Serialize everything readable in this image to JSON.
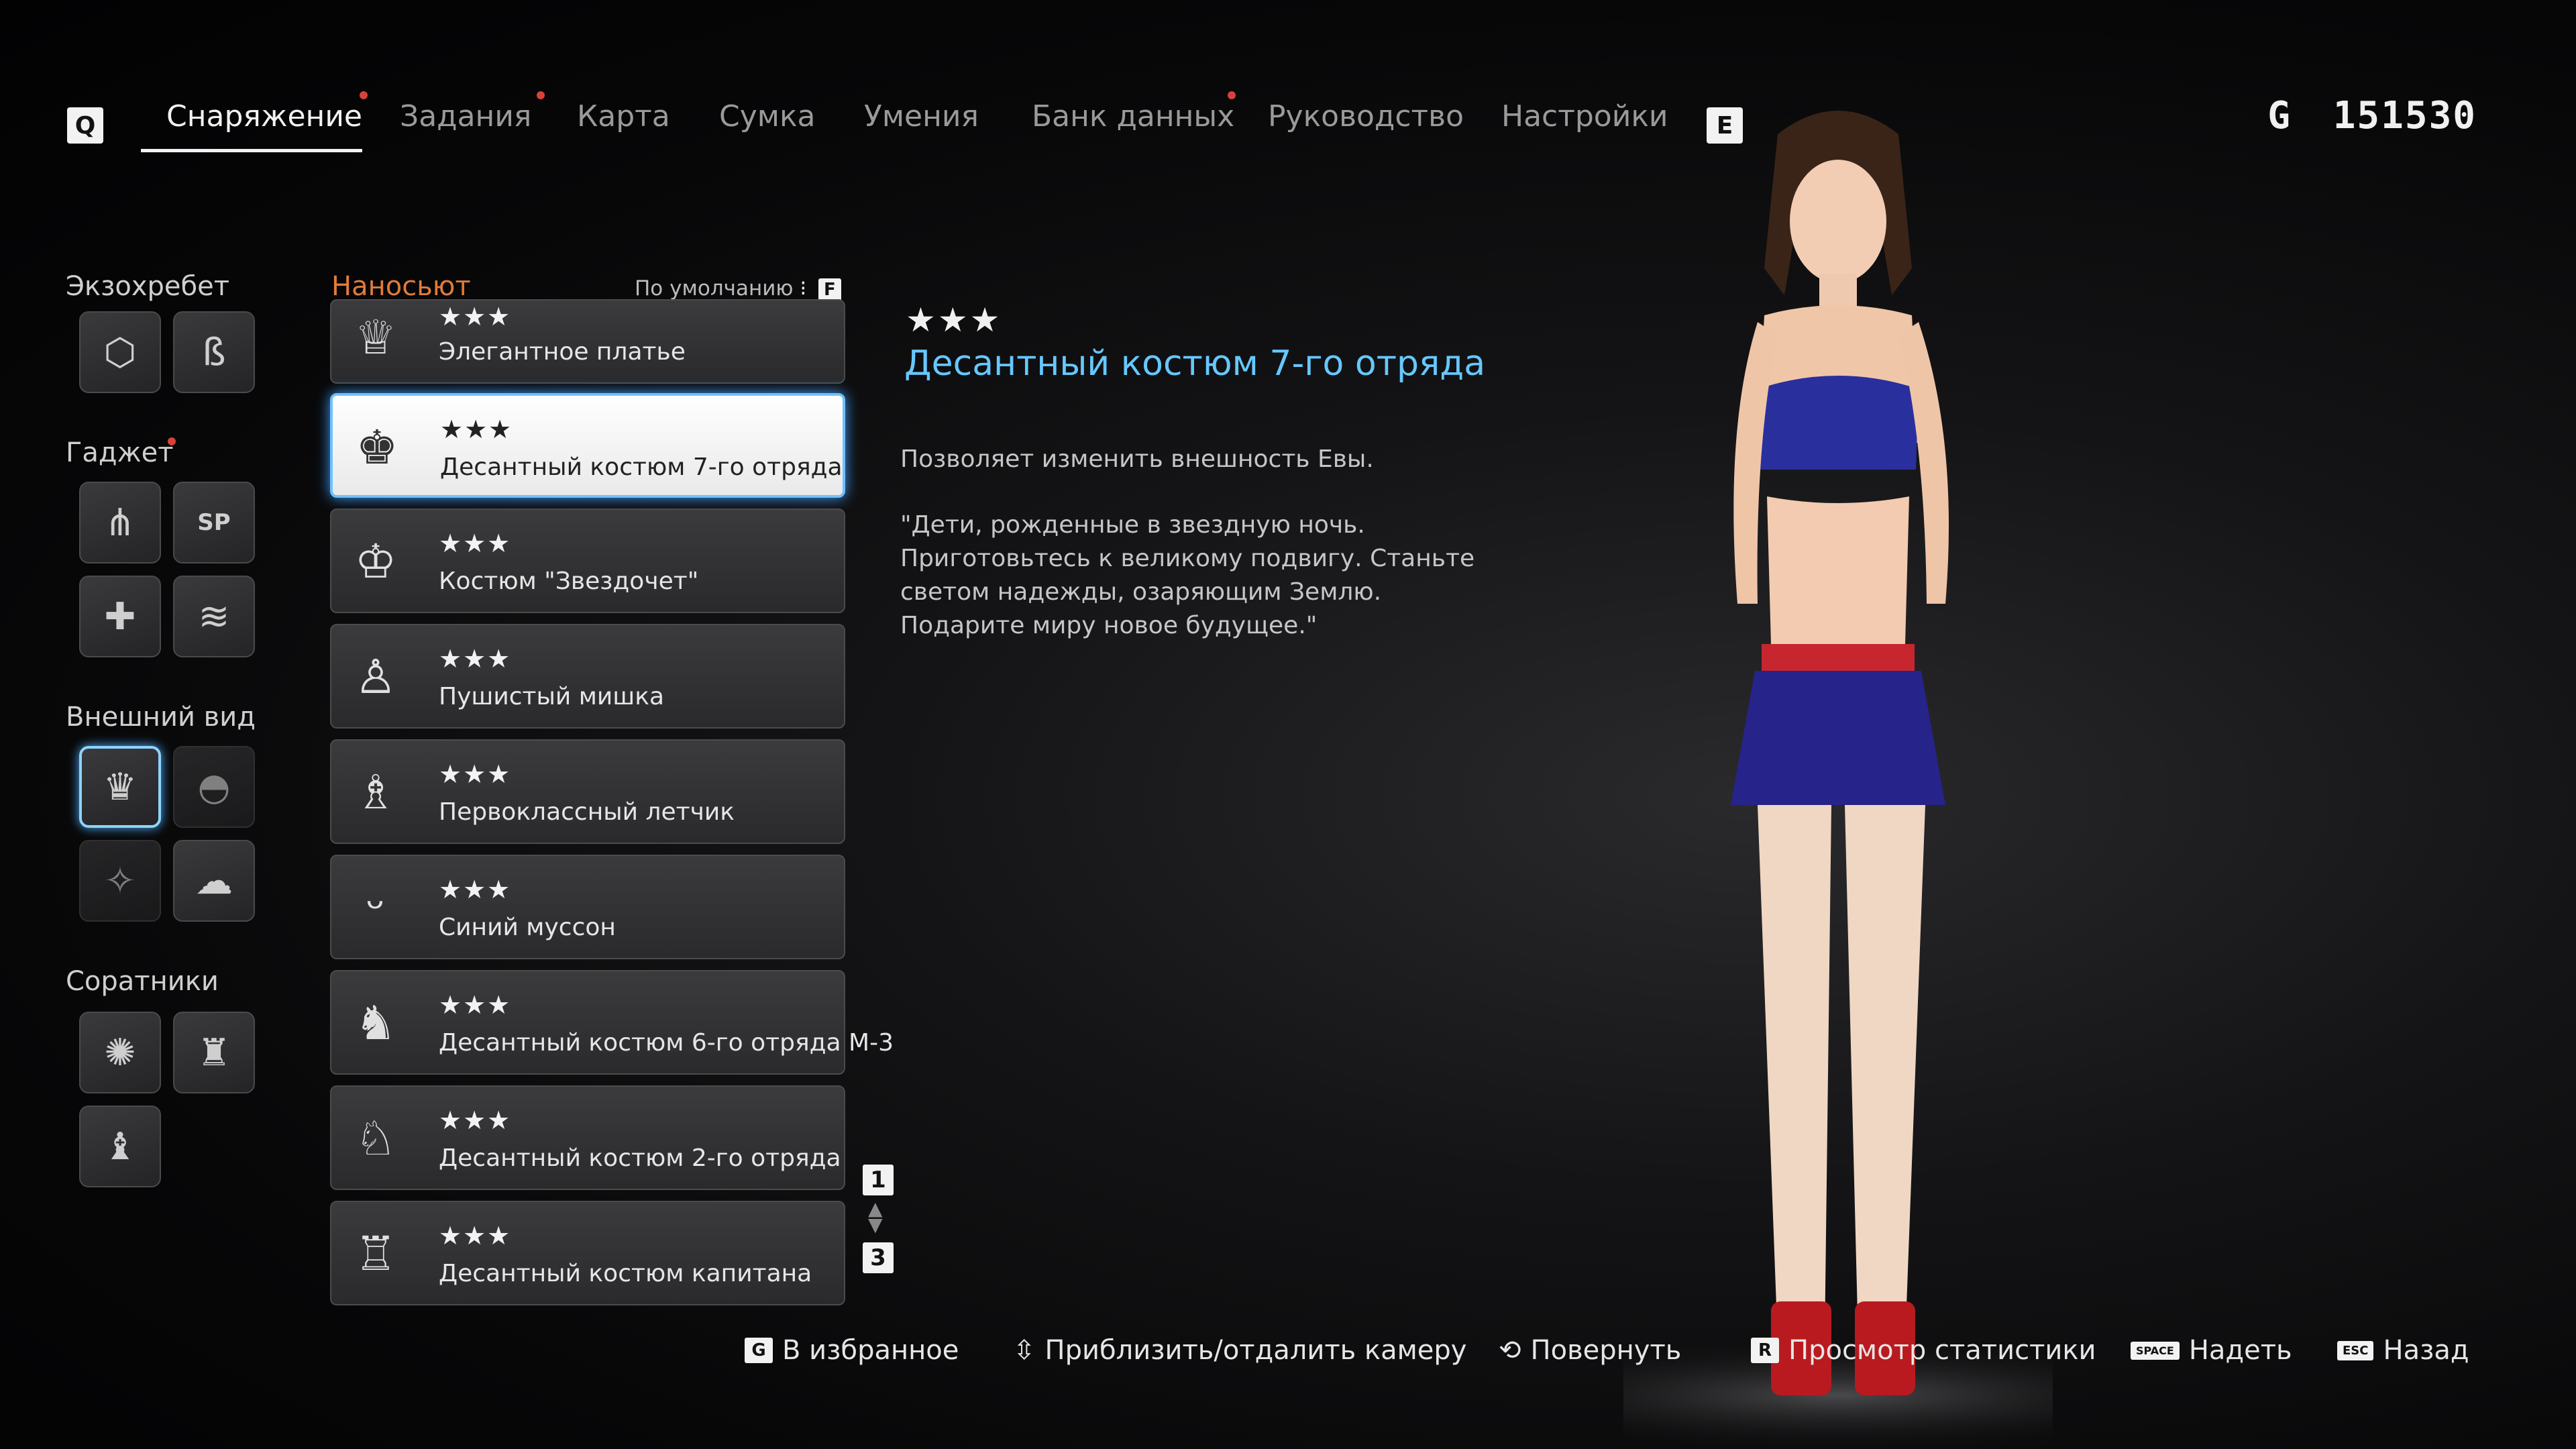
{
  "nav": {
    "left_key": "Q",
    "right_key": "E",
    "tabs": [
      {
        "label": "Снаряжение",
        "active": true,
        "dot": true
      },
      {
        "label": "Задания",
        "active": false,
        "dot": true
      },
      {
        "label": "Карта",
        "active": false,
        "dot": false
      },
      {
        "label": "Сумка",
        "active": false,
        "dot": false
      },
      {
        "label": "Умения",
        "active": false,
        "dot": false
      },
      {
        "label": "Банк данных",
        "active": false,
        "dot": true
      },
      {
        "label": "Руководство",
        "active": false,
        "dot": false
      },
      {
        "label": "Настройки",
        "active": false,
        "dot": false
      }
    ],
    "currency_symbol": "G",
    "currency_value": "151530"
  },
  "categories": {
    "exospine": "Экзохребет",
    "gadget": "Гаджет",
    "appearance": "Внешний вид",
    "companions": "Соратники"
  },
  "list": {
    "header": "Наносьют",
    "sort_label": "По умолчанию",
    "sort_key": "F",
    "items": [
      {
        "stars": "★★★",
        "name": "Элегантное платье",
        "icon": "dress-icon"
      },
      {
        "stars": "★★★",
        "name": "Десантный костюм 7-го отряда",
        "icon": "squad7-suit-icon",
        "selected": true
      },
      {
        "stars": "★★★",
        "name": "Костюм \"Звездочет\"",
        "icon": "stargazer-suit-icon"
      },
      {
        "stars": "★★★",
        "name": "Пушистый мишка",
        "icon": "fluffy-bear-icon"
      },
      {
        "stars": "★★★",
        "name": "Первоклассный летчик",
        "icon": "pilot-suit-icon"
      },
      {
        "stars": "★★★",
        "name": "Синий муссон",
        "icon": "swimsuit-icon"
      },
      {
        "stars": "★★★",
        "name": "Десантный костюм 6-го отряда М-3",
        "icon": "squad6-suit-icon"
      },
      {
        "stars": "★★★",
        "name": "Десантный костюм 2-го отряда",
        "icon": "squad2-suit-icon"
      },
      {
        "stars": "★★★",
        "name": "Десантный костюм капитана",
        "icon": "captain-suit-icon"
      }
    ],
    "page_top": "1",
    "page_bottom": "3"
  },
  "detail": {
    "stars": "★★★",
    "title": "Десантный костюм 7-го отряда",
    "description": "Позволяет изменить внешность Евы.",
    "quote": "\"Дети, рожденные в звездную ночь. Приготовьтесь к великому подвигу. Станьте светом надежды, озаряющим Землю. Подарите миру новое будущее.\""
  },
  "hints": [
    {
      "key": "G",
      "label": "В избранное"
    },
    {
      "key": "",
      "label": "Приблизить/отдалить камеру",
      "icon": "mouse-wheel-icon"
    },
    {
      "key": "",
      "label": "Повернуть",
      "icon": "mouse-drag-icon"
    },
    {
      "key": "R",
      "label": "Просмотр статистики"
    },
    {
      "key": "SPACE",
      "label": "Надеть"
    },
    {
      "key": "ESC",
      "label": "Назад"
    }
  ]
}
